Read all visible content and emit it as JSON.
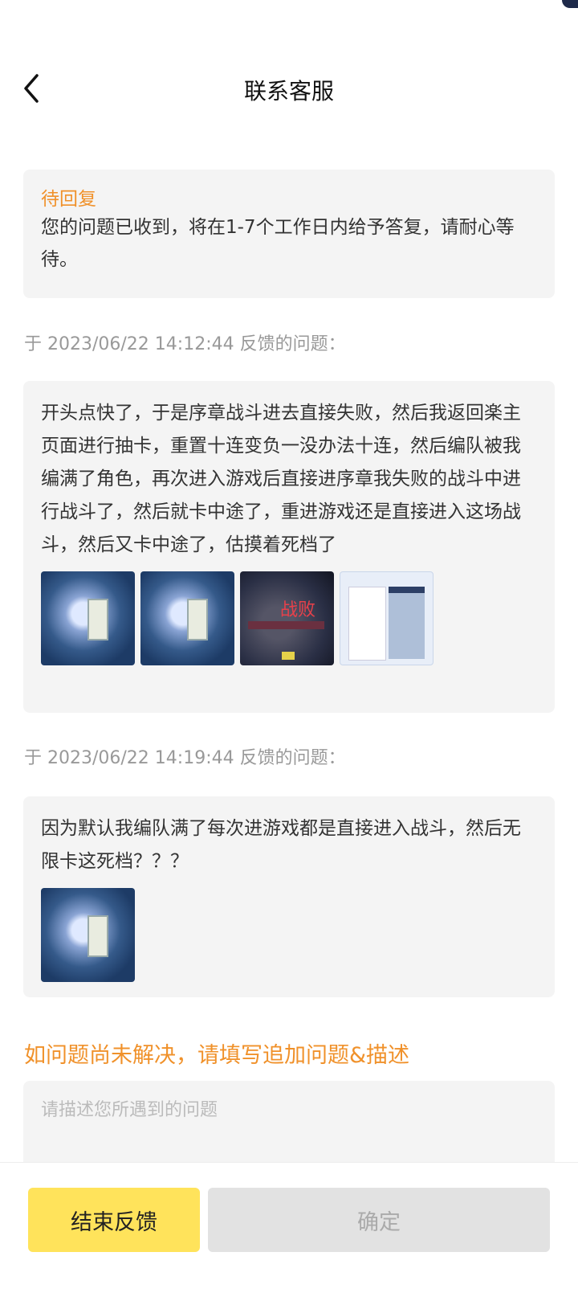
{
  "header": {
    "title": "联系客服",
    "back_icon": "chevron-left-icon"
  },
  "status_card": {
    "label": "待回复",
    "message": "您的问题已收到，将在1-7个工作日内给予答复，请耐心等待。"
  },
  "feedback": [
    {
      "timestamp": "于 2023/06/22 14:12:44 反馈的问题：",
      "content": "开头点快了，于是序章战斗进去直接失败，然后我返回楽主页面进行抽卡，重置十连变负一没办法十连，然后编队被我编满了角色，再次进入游戏后直接进序章我失败的战斗中进行战斗了，然后就卡中途了，重进游戏还是直接进入这场战斗，然后又卡中途了，估摸着死档了",
      "thumbnails": [
        "screenshot-battle",
        "screenshot-battle",
        "screenshot-defeat",
        "screenshot-panel"
      ]
    },
    {
      "timestamp": "于 2023/06/22 14:19:44 反馈的问题：",
      "content": "因为默认我编队满了每次进游戏都是直接进入战斗，然后无限卡这死档？？？",
      "thumbnails": [
        "screenshot-battle"
      ]
    }
  ],
  "followup": {
    "prompt": "如问题尚未解决，请填写追加问题&描述",
    "placeholder": "请描述您所遇到的问题",
    "value": ""
  },
  "defeat_thumb_text": "战败",
  "footer": {
    "end_label": "结束反馈",
    "confirm_label": "确定"
  },
  "colors": {
    "accent_orange": "#f0912a",
    "end_button": "#ffe35b",
    "disabled_button": "#e2e2e2",
    "card_bg": "#f4f4f4"
  }
}
